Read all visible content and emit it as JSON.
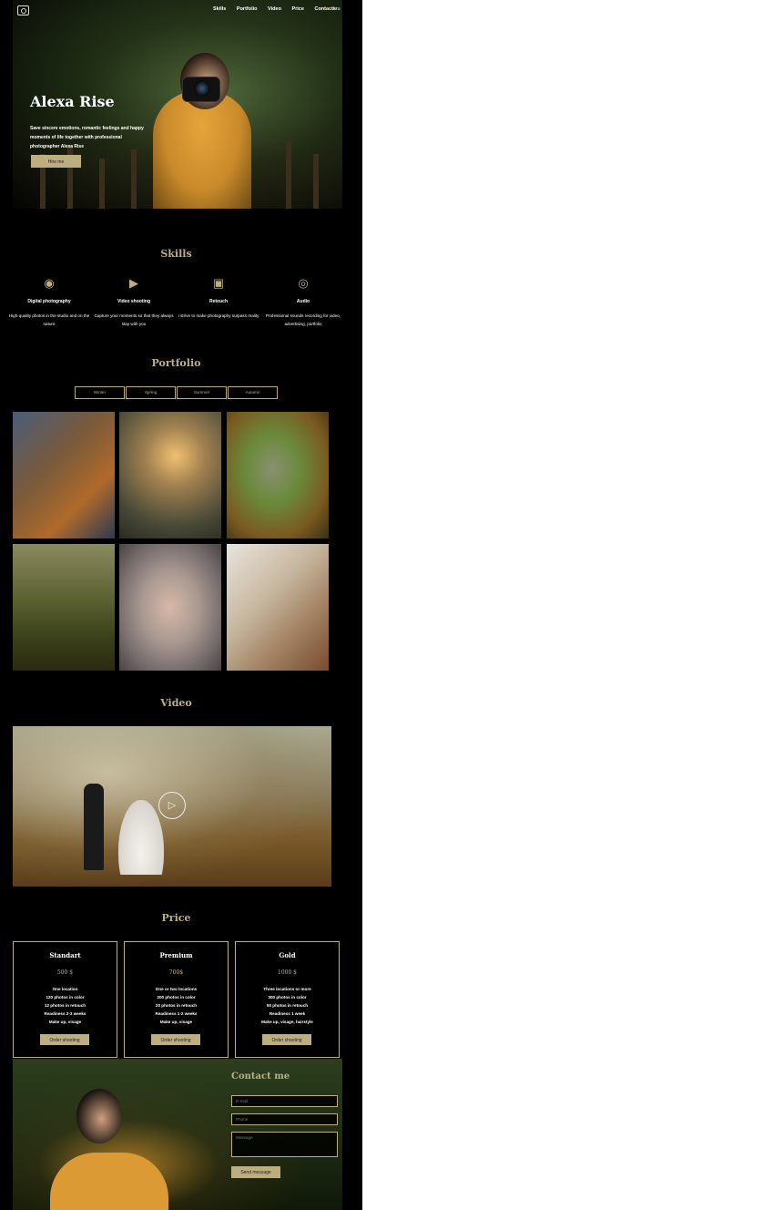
{
  "header": {
    "logo_icon": "camera-logo-icon",
    "nav": [
      "Skills",
      "Portfolio",
      "Video",
      "Price",
      "Contacts"
    ],
    "lang": {
      "active": "en",
      "separator": "/",
      "other": "ru"
    }
  },
  "hero": {
    "title": "Alexa Rise",
    "text": "Save sincere emotions, romantic feelings and happy moments of life together with professional photographer Alexa Rise",
    "button": "Hire me"
  },
  "skills": {
    "title": "Skills",
    "items": [
      {
        "icon": "camera-icon",
        "title": "Digital photography",
        "text": "High-quality photos in the studio and on the nature"
      },
      {
        "icon": "video-icon",
        "title": "Video shooting",
        "text": "Capture your moments so that they always stay with you"
      },
      {
        "icon": "image-icon",
        "title": "Retouch",
        "text": "I strive to make photography surpass reality"
      },
      {
        "icon": "microphone-icon",
        "title": "Audio",
        "text": "Professional sounds recording for video, advertising, portfolio"
      }
    ]
  },
  "portfolio": {
    "title": "Portfolio",
    "tabs": [
      "Winter",
      "Spring",
      "Summer",
      "Autumn"
    ]
  },
  "video": {
    "title": "Video",
    "play_icon": "play-icon"
  },
  "price": {
    "title": "Price",
    "plans": [
      {
        "name": "Standart",
        "amount": "500 $",
        "features": [
          "One location",
          "120 photos in color",
          "12 photos in retouch",
          "Readiness 2-3 weeks",
          "Make up, visage"
        ],
        "button": "Order shooting"
      },
      {
        "name": "Premium",
        "amount": "700$",
        "features": [
          "One or two locations",
          "200 photos in color",
          "20 photos in retouch",
          "Readiness 1-2 weeks",
          "Make up, visage"
        ],
        "button": "Order shooting"
      },
      {
        "name": "Gold",
        "amount": "1000 $",
        "features": [
          "Three locations or more",
          "300 photos in color",
          "50 photos in retouch",
          "Readiness 1 week",
          "Make up, visage, hairstyle"
        ],
        "button": "Order shooting"
      }
    ]
  },
  "contact": {
    "title": "Contact me",
    "email_placeholder": "E-mail",
    "phone_placeholder": "Phone",
    "message_placeholder": "Message",
    "button": "Send message"
  },
  "colors": {
    "accent": "#bdae82",
    "background": "#000000"
  }
}
